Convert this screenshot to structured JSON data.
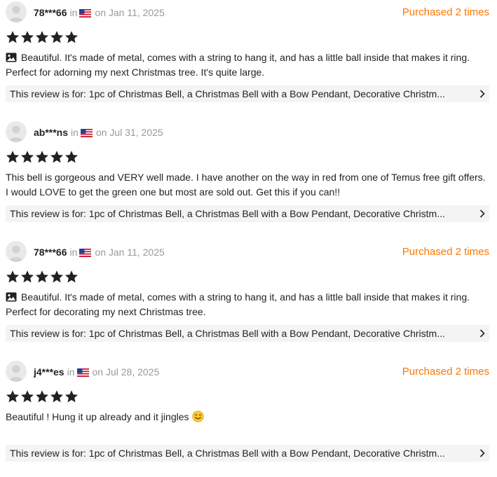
{
  "reviews": [
    {
      "user": "78***66",
      "in_text": "in",
      "date": "on Jan 11, 2025",
      "purchased": "Purchased 2 times",
      "rating": 5,
      "has_photo": true,
      "text": "Beautiful. It's made of metal, comes with a string to hang it, and has a little ball inside that makes it ring. Perfect for adorning my next Christmas tree. It's quite large.",
      "product": "This review is for: 1pc of Christmas Bell, a Christmas Bell with a Bow Pendant, Decorative Christm..."
    },
    {
      "user": "ab***ns",
      "in_text": "in",
      "date": "on Jul 31, 2025",
      "purchased": "",
      "rating": 5,
      "has_photo": false,
      "text": "This bell is gorgeous and VERY well made. I have another on the way in red from one of Temus free gift offers. I would LOVE to get the green one but most are sold out. Get this if you can!!",
      "product": "This review is for: 1pc of Christmas Bell, a Christmas Bell with a Bow Pendant, Decorative Christm..."
    },
    {
      "user": "78***66",
      "in_text": "in",
      "date": "on Jan 11, 2025",
      "purchased": "Purchased 2 times",
      "rating": 5,
      "has_photo": true,
      "text": "Beautiful. It's made of metal, comes with a string to hang it, and has a little ball inside that makes it ring. Perfect for decorating my next Christmas tree.",
      "product": "This review is for: 1pc of Christmas Bell, a Christmas Bell with a Bow Pendant, Decorative Christm..."
    },
    {
      "user": "j4***es",
      "in_text": "in",
      "date": "on Jul 28, 2025",
      "purchased": "Purchased 2 times",
      "rating": 5,
      "has_photo": false,
      "text": "Beautiful ! Hung it up already and it jingles",
      "has_emoji": true,
      "product": "This review is for: 1pc of Christmas Bell, a Christmas Bell with a Bow Pendant, Decorative Christm..."
    }
  ],
  "icons": {
    "avatar": "avatar-placeholder-icon",
    "flag": "us-flag-icon",
    "star": "star-icon",
    "photo": "photo-icon",
    "emoji": "smiling-face-emoji-icon",
    "chevron": "chevron-right-icon"
  },
  "colors": {
    "purchased": "#fb7701",
    "star": "#222222",
    "product_bar": "#f4f4f4",
    "meta_text": "#999999"
  }
}
